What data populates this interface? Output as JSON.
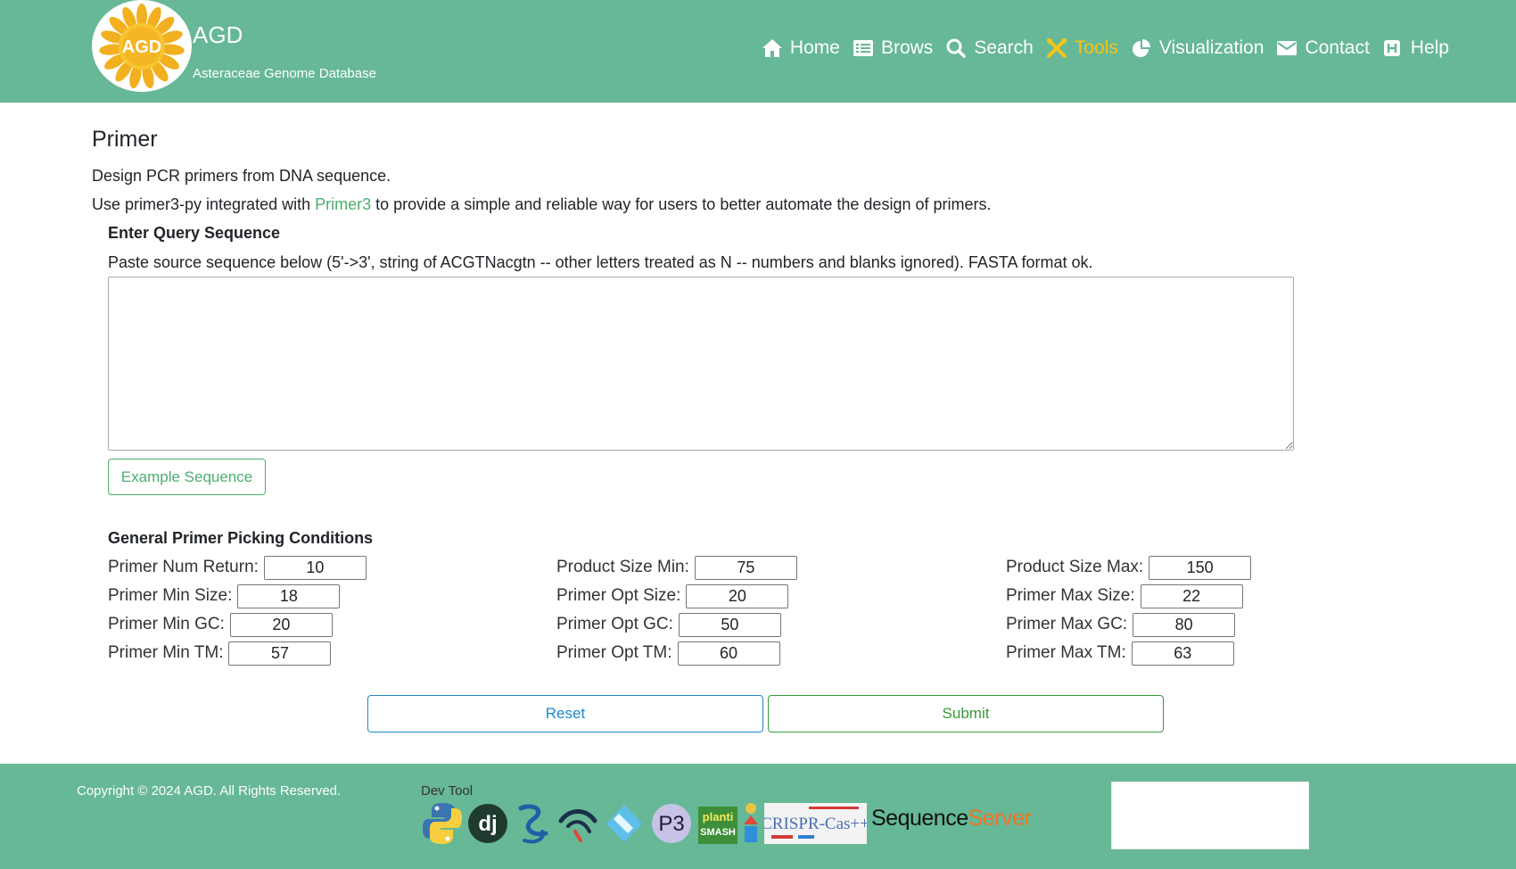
{
  "header": {
    "brand_title": "AGD",
    "brand_subtitle": "Asteraceae Genome Database",
    "logo_text": "AGD",
    "nav": [
      {
        "label": "Home",
        "icon": "home-icon"
      },
      {
        "label": "Brows",
        "icon": "list-icon"
      },
      {
        "label": "Search",
        "icon": "search-icon"
      },
      {
        "label": "Tools",
        "icon": "tools-icon",
        "active": true
      },
      {
        "label": "Visualization",
        "icon": "pie-chart-icon"
      },
      {
        "label": "Contact",
        "icon": "envelope-icon"
      },
      {
        "label": "Help",
        "icon": "help-icon"
      }
    ],
    "colors": {
      "background": "#66b896",
      "active": "#f5c518",
      "text": "#ffffff"
    }
  },
  "main": {
    "title": "Primer",
    "description": "Design PCR primers from DNA sequence.",
    "usage_prefix": "Use primer3-py integrated with ",
    "usage_link": "Primer3",
    "usage_suffix": " to provide a simple and reliable way for users to better automate the design of primers.",
    "query_title": "Enter Query Sequence",
    "query_hint": "Paste source sequence below (5'->3', string of ACGTNacgtn -- other letters treated as N -- numbers and blanks ignored). FASTA format ok.",
    "sequence_value": "",
    "example_button": "Example Sequence",
    "conditions_title": "General Primer Picking Conditions",
    "params": {
      "num_return": {
        "label": "Primer Num Return:",
        "value": "10"
      },
      "product_size_min": {
        "label": "Product Size Min:",
        "value": "75"
      },
      "product_size_max": {
        "label": "Product Size Max:",
        "value": "150"
      },
      "min_size": {
        "label": "Primer Min Size:",
        "value": "18"
      },
      "opt_size": {
        "label": "Primer Opt Size:",
        "value": "20"
      },
      "max_size": {
        "label": "Primer Max Size:",
        "value": "22"
      },
      "min_gc": {
        "label": "Primer Min GC:",
        "value": "20"
      },
      "opt_gc": {
        "label": "Primer Opt GC:",
        "value": "50"
      },
      "max_gc": {
        "label": "Primer Max GC:",
        "value": "80"
      },
      "min_tm": {
        "label": "Primer Min TM:",
        "value": "57"
      },
      "opt_tm": {
        "label": "Primer Opt TM:",
        "value": "60"
      },
      "max_tm": {
        "label": "Primer Max TM:",
        "value": "63"
      }
    },
    "reset_button": "Reset",
    "submit_button": "Submit",
    "colors": {
      "link": "#4cae6f",
      "reset": "#1e88c9",
      "submit": "#3a9a3a"
    }
  },
  "footer": {
    "copyright": "Copyright © 2024 AGD. All Rights Reserved.",
    "dev_tool_label": "Dev Tool",
    "tools": [
      {
        "name": "python-logo-icon"
      },
      {
        "name": "django-logo-icon",
        "text": "dj"
      },
      {
        "name": "helix-logo-icon"
      },
      {
        "name": "arc-logo-icon"
      },
      {
        "name": "diamond-logo-icon"
      },
      {
        "name": "p3-logo-icon",
        "text": "P3"
      },
      {
        "name": "plantismash-logo-icon",
        "text_top": "planti",
        "text_bottom": "SMASH"
      },
      {
        "name": "person-logo-icon"
      },
      {
        "name": "crispr-cas-logo-icon",
        "text": "CRISPR-Cas++"
      }
    ],
    "sequenceserver_a": "Sequence",
    "sequenceserver_b": "Server"
  }
}
